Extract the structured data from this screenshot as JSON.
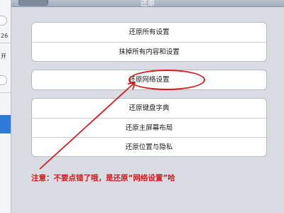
{
  "sidebar": {
    "label_1": "26",
    "label_2": "开"
  },
  "navbar": {
    "title": "还原"
  },
  "group_1": {
    "items": [
      "还原所有设置",
      "抹掉所有内容和设置"
    ]
  },
  "group_2": {
    "items": [
      "还原网络设置"
    ]
  },
  "group_3": {
    "items": [
      "还原键盘字典",
      "还原主屏幕布局",
      "还原位置与隐私"
    ]
  },
  "annotation": {
    "note": "注意：不要点错了哦，是还原“网络设置”哈",
    "color": "#cc1b1b"
  }
}
